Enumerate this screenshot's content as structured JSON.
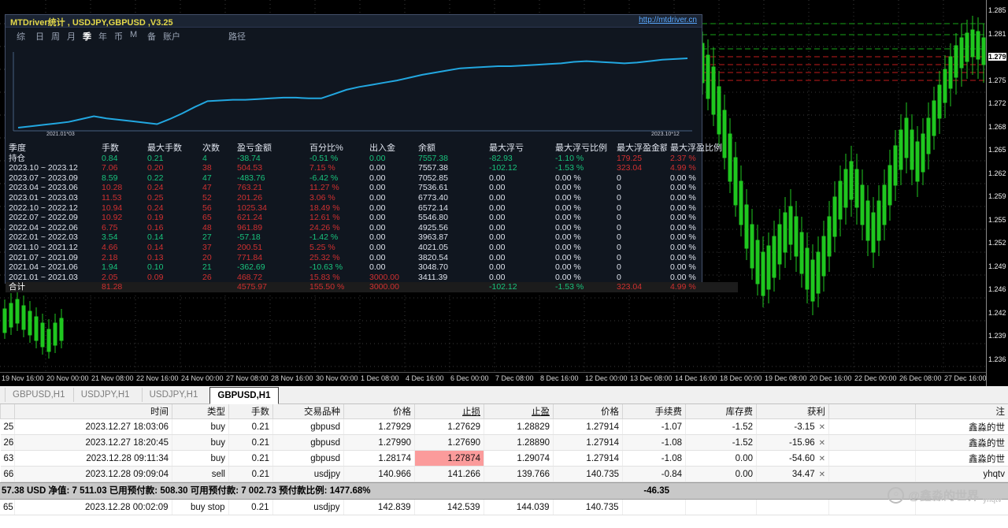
{
  "price_chart": {
    "symbol_tab": "GBPUSD,H1",
    "current_price": "1.279",
    "price_ticks": [
      "1.285",
      "1.281",
      "1.279",
      "1.275",
      "1.272",
      "1.268",
      "1.265",
      "1.262",
      "1.259",
      "1.255",
      "1.252",
      "1.249",
      "1.246",
      "1.242",
      "1.239",
      "1.236"
    ],
    "time_ticks": [
      "19 Nov 16:00",
      "20 Nov 00:00",
      "21 Nov 08:00",
      "22 Nov 16:00",
      "24 Nov 00:00",
      "27 Nov 08:00",
      "28 Nov 16:00",
      "30 Nov 00:00",
      "1 Dec 08:00",
      "4 Dec 16:00",
      "6 Dec 00:00",
      "7 Dec 08:00",
      "8 Dec 16:00",
      "12 Dec 00:00",
      "13 Dec 08:00",
      "14 Dec 16:00",
      "18 Dec 00:00",
      "19 Dec 08:00",
      "20 Dec 16:00",
      "22 Dec 00:00",
      "26 Dec 08:00",
      "27 Dec 16:00"
    ]
  },
  "stats_panel": {
    "title": "MTDriver统计 , USDJPY,GBPUSD ,V3.25",
    "url": "http://mtdriver.cn",
    "menu": [
      "综",
      "日",
      "周",
      "月",
      "季",
      "年",
      "币",
      "M",
      "备",
      "账户",
      "路径"
    ],
    "menu_active": "季",
    "equity_chart": {
      "type": "line",
      "start_label": "2021.01*03",
      "end_label": "2023.10*12",
      "ylabel": "",
      "xlabel": "",
      "values": [
        0,
        2,
        4,
        6,
        8,
        12,
        16,
        13,
        11,
        9,
        7,
        5,
        12,
        20,
        29,
        37,
        38,
        39,
        39,
        40,
        41,
        42,
        42,
        41,
        41,
        47,
        53,
        57,
        60,
        63,
        66,
        70,
        74,
        77,
        80,
        83,
        84,
        85,
        86,
        86,
        87,
        88,
        89,
        90,
        92,
        93,
        92,
        91,
        90,
        91,
        93,
        95,
        96,
        97
      ]
    },
    "columns": [
      "季度",
      "手数",
      "最大手数",
      "次数",
      "盈亏金额",
      "百分比%",
      "出入金",
      "余额",
      "最大浮亏",
      "最大浮亏比例",
      "最大浮盈金额",
      "最大浮盈比例"
    ],
    "rows": [
      {
        "tone": "green",
        "cells": [
          "持仓",
          "0.84",
          "0.21",
          "4",
          "-38.74",
          "-0.51 %",
          "0.00",
          "7557.38",
          "-82.93",
          "-1.10 %",
          "179.25",
          "2.37 %"
        ],
        "mixed": {
          "10": "red",
          "11": "red"
        }
      },
      {
        "tone": "red",
        "cells": [
          "2023.10 ~ 2023.12",
          "7.06",
          "0.20",
          "38",
          "504.53",
          "7.15 %",
          "0.00",
          "7557.38",
          "-102.12",
          "-1.53 %",
          "323.04",
          "4.99 %"
        ],
        "mixed": {
          "6": "plain",
          "7": "plain",
          "8": "green",
          "9": "green"
        }
      },
      {
        "tone": "green",
        "cells": [
          "2023.07 ~ 2023.09",
          "8.59",
          "0.22",
          "47",
          "-483.76",
          "-6.42 %",
          "0.00",
          "7052.85",
          "0.00",
          "0.00 %",
          "0",
          "0.00 %"
        ],
        "mixed": {
          "6": "plain",
          "7": "plain",
          "8": "plain",
          "9": "plain",
          "10": "plain",
          "11": "plain"
        }
      },
      {
        "tone": "red",
        "cells": [
          "2023.04 ~ 2023.06",
          "10.28",
          "0.24",
          "47",
          "763.21",
          "11.27 %",
          "0.00",
          "7536.61",
          "0.00",
          "0.00 %",
          "0",
          "0.00 %"
        ],
        "mixed": {
          "6": "plain",
          "7": "plain",
          "8": "plain",
          "9": "plain",
          "10": "plain",
          "11": "plain"
        }
      },
      {
        "tone": "red",
        "cells": [
          "2023.01 ~ 2023.03",
          "11.53",
          "0.25",
          "52",
          "201.26",
          "3.06 %",
          "0.00",
          "6773.40",
          "0.00",
          "0.00 %",
          "0",
          "0.00 %"
        ],
        "mixed": {
          "6": "plain",
          "7": "plain",
          "8": "plain",
          "9": "plain",
          "10": "plain",
          "11": "plain"
        }
      },
      {
        "tone": "red",
        "cells": [
          "2022.10 ~ 2022.12",
          "10.94",
          "0.24",
          "56",
          "1025.34",
          "18.49 %",
          "0.00",
          "6572.14",
          "0.00",
          "0.00 %",
          "0",
          "0.00 %"
        ],
        "mixed": {
          "6": "plain",
          "7": "plain",
          "8": "plain",
          "9": "plain",
          "10": "plain",
          "11": "plain"
        }
      },
      {
        "tone": "red",
        "cells": [
          "2022.07 ~ 2022.09",
          "10.92",
          "0.19",
          "65",
          "621.24",
          "12.61 %",
          "0.00",
          "5546.80",
          "0.00",
          "0.00 %",
          "0",
          "0.00 %"
        ],
        "mixed": {
          "6": "plain",
          "7": "plain",
          "8": "plain",
          "9": "plain",
          "10": "plain",
          "11": "plain"
        }
      },
      {
        "tone": "red",
        "cells": [
          "2022.04 ~ 2022.06",
          "6.75",
          "0.16",
          "48",
          "961.89",
          "24.26 %",
          "0.00",
          "4925.56",
          "0.00",
          "0.00 %",
          "0",
          "0.00 %"
        ],
        "mixed": {
          "6": "plain",
          "7": "plain",
          "8": "plain",
          "9": "plain",
          "10": "plain",
          "11": "plain"
        }
      },
      {
        "tone": "green",
        "cells": [
          "2022.01 ~ 2022.03",
          "3.54",
          "0.14",
          "27",
          "-57.18",
          "-1.42 %",
          "0.00",
          "3963.87",
          "0.00",
          "0.00 %",
          "0",
          "0.00 %"
        ],
        "mixed": {
          "6": "plain",
          "7": "plain",
          "8": "plain",
          "9": "plain",
          "10": "plain",
          "11": "plain"
        }
      },
      {
        "tone": "red",
        "cells": [
          "2021.10 ~ 2021.12",
          "4.66",
          "0.14",
          "37",
          "200.51",
          "5.25 %",
          "0.00",
          "4021.05",
          "0.00",
          "0.00 %",
          "0",
          "0.00 %"
        ],
        "mixed": {
          "6": "plain",
          "7": "plain",
          "8": "plain",
          "9": "plain",
          "10": "plain",
          "11": "plain"
        }
      },
      {
        "tone": "red",
        "cells": [
          "2021.07 ~ 2021.09",
          "2.18",
          "0.13",
          "20",
          "771.84",
          "25.32 %",
          "0.00",
          "3820.54",
          "0.00",
          "0.00 %",
          "0",
          "0.00 %"
        ],
        "mixed": {
          "6": "plain",
          "7": "plain",
          "8": "plain",
          "9": "plain",
          "10": "plain",
          "11": "plain"
        }
      },
      {
        "tone": "green",
        "cells": [
          "2021.04 ~ 2021.06",
          "1.94",
          "0.10",
          "21",
          "-362.69",
          "-10.63 %",
          "0.00",
          "3048.70",
          "0.00",
          "0.00 %",
          "0",
          "0.00 %"
        ],
        "mixed": {
          "6": "plain",
          "7": "plain",
          "8": "plain",
          "9": "plain",
          "10": "plain",
          "11": "plain"
        }
      },
      {
        "tone": "red",
        "cells": [
          "2021.01 ~ 2021.03",
          "2.05",
          "0.09",
          "26",
          "468.72",
          "15.83 %",
          "3000.00",
          "3411.39",
          "0.00",
          "0.00 %",
          "0",
          "0.00 %"
        ],
        "mixed": {
          "7": "plain",
          "8": "plain",
          "9": "plain",
          "10": "plain",
          "11": "plain"
        }
      }
    ],
    "total_row": {
      "label": "合计",
      "cells": [
        "合计",
        "81.28",
        "",
        "",
        "4575.97",
        "155.50 %",
        "3000.00",
        "",
        "-102.12",
        "-1.53 %",
        "323.04",
        "4.99 %"
      ]
    }
  },
  "terminal": {
    "tabs": [
      {
        "label": "GBPUSD,H1",
        "active": false
      },
      {
        "label": "USDJPY,H1",
        "active": false
      },
      {
        "label": "USDJPY,H1",
        "active": false
      },
      {
        "label": "GBPUSD,H1",
        "active": true
      }
    ],
    "columns": [
      "",
      "时间",
      "类型",
      "手数",
      "交易品种",
      "价格",
      "止损",
      "止盈",
      "价格",
      "手续费",
      "库存费",
      "获利",
      "",
      "注"
    ],
    "underlined_columns": [
      "止损",
      "止盈"
    ],
    "rows": [
      {
        "id": "25",
        "time": "2023.12.27 18:03:06",
        "type": "buy",
        "lots": "0.21",
        "symbol": "gbpusd",
        "price": "1.27929",
        "sl": "1.27629",
        "tp": "1.28829",
        "cur": "1.27914",
        "commission": "-1.07",
        "swap": "-1.52",
        "profit": "-3.15",
        "comment": "鑫淼的世",
        "sl_hot": false
      },
      {
        "id": "26",
        "time": "2023.12.27 18:20:45",
        "type": "buy",
        "lots": "0.21",
        "symbol": "gbpusd",
        "price": "1.27990",
        "sl": "1.27690",
        "tp": "1.28890",
        "cur": "1.27914",
        "commission": "-1.08",
        "swap": "-1.52",
        "profit": "-15.96",
        "comment": "鑫淼的世",
        "sl_hot": false
      },
      {
        "id": "63",
        "time": "2023.12.28 09:11:34",
        "type": "buy",
        "lots": "0.21",
        "symbol": "gbpusd",
        "price": "1.28174",
        "sl": "1.27874",
        "tp": "1.29074",
        "cur": "1.27914",
        "commission": "-1.08",
        "swap": "0.00",
        "profit": "-54.60",
        "comment": "鑫淼的世",
        "sl_hot": true
      },
      {
        "id": "66",
        "time": "2023.12.28 09:09:04",
        "type": "sell",
        "lots": "0.21",
        "symbol": "usdjpy",
        "price": "140.966",
        "sl": "141.266",
        "tp": "139.766",
        "cur": "140.735",
        "commission": "-0.84",
        "swap": "0.00",
        "profit": "34.47",
        "comment": "yhqtv",
        "sl_hot": false
      }
    ],
    "balance_row": {
      "text": "57.38 USD  净值: 7 511.03  已用预付款: 508.30  可用预付款: 7 002.73  预付款比例: 1477.68%",
      "total": "-46.35"
    },
    "pending_row": {
      "id": "65",
      "time": "2023.12.28 00:02:09",
      "type": "buy stop",
      "lots": "0.21",
      "symbol": "usdjpy",
      "price": "142.839",
      "sl": "142.539",
      "tp": "144.039",
      "cur": "140.735",
      "commission": "",
      "swap": "",
      "profit": "",
      "comment": ""
    }
  },
  "watermark": {
    "handle": "@鑫淼的世界",
    "sub": "yhqtv"
  }
}
